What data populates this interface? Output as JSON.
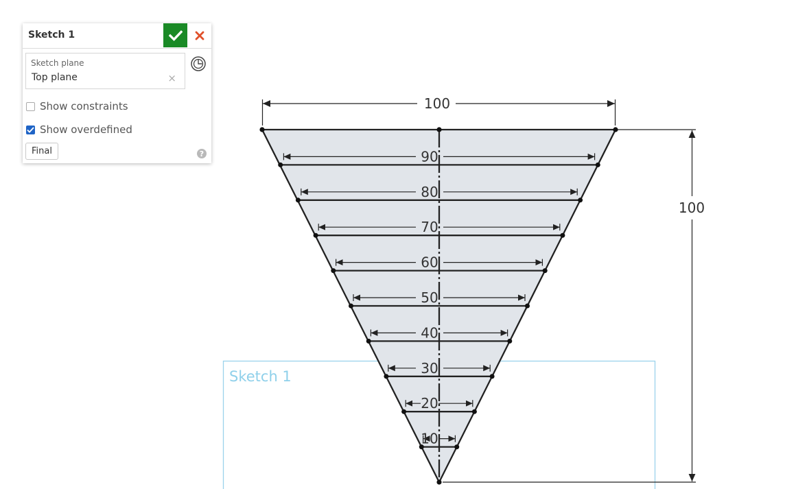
{
  "dialog": {
    "title": "Sketch 1",
    "plane_label": "Sketch plane",
    "plane_value": "Top plane",
    "clear_glyph": "×",
    "show_constraints_label": "Show constraints",
    "show_constraints_checked": false,
    "show_overdefined_label": "Show overdefined",
    "show_overdefined_checked": true,
    "final_label": "Final",
    "help_glyph": "?"
  },
  "sketch": {
    "label": "Sketch 1",
    "top_width": 100,
    "height": 100,
    "width_dims": [
      90,
      80,
      70,
      60,
      50,
      40,
      30,
      20,
      10
    ]
  },
  "icons": {
    "confirm": "check-icon",
    "cancel": "close-icon",
    "view_normal": "view-normal-icon",
    "help": "help-icon"
  },
  "colors": {
    "confirm_bg": "#1a8a26",
    "cancel": "#e0502a",
    "checkbox_checked": "#1f64c6",
    "region_fill": "#e1e5ea",
    "sketch_frame": "#9bd3ec"
  }
}
